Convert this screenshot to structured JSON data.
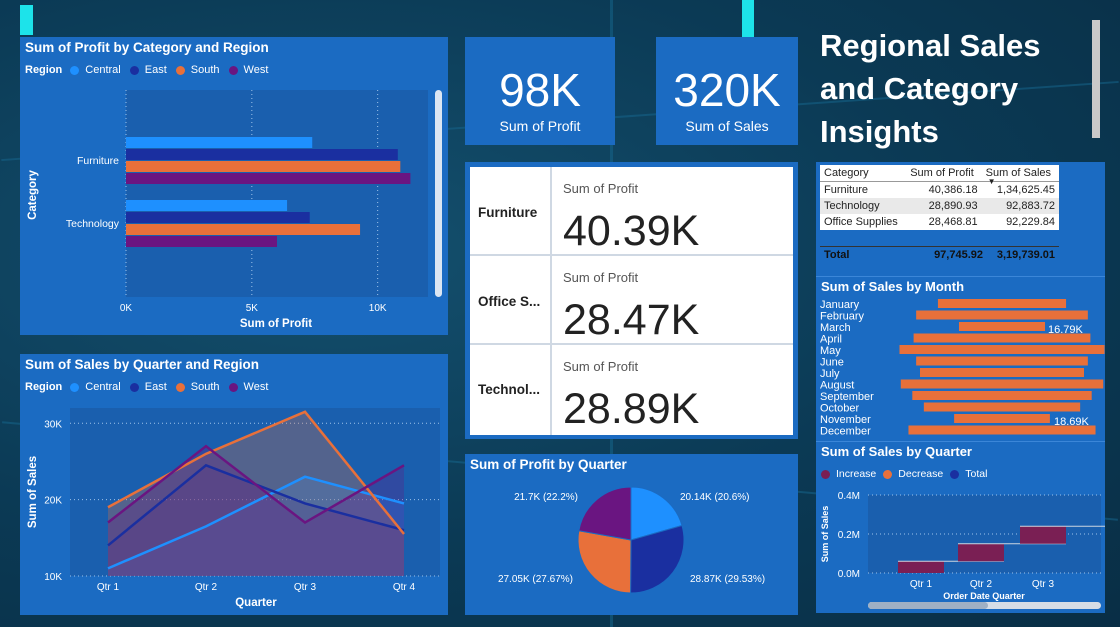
{
  "page_title": "Regional Sales and Category Insights",
  "colors": {
    "central": "#1e90ff",
    "east": "#1a2fa0",
    "south": "#e8703a",
    "west": "#6a1581",
    "panel": "#1b6bc2",
    "increase": "#7a1f54",
    "decrease": "#e8703a",
    "total": "#1a2fa0"
  },
  "kpis": [
    {
      "value": "98K",
      "label": "Sum of Profit"
    },
    {
      "value": "320K",
      "label": "Sum of Sales"
    }
  ],
  "legend": {
    "title": "Region",
    "items": [
      "Central",
      "East",
      "South",
      "West"
    ]
  },
  "profit_by_cat_region": {
    "title": "Sum of Profit by Category and Region",
    "ylabel": "Category",
    "xlabel": "Sum of Profit",
    "ticks": [
      "0K",
      "5K",
      "10K"
    ]
  },
  "sales_by_quarter_region": {
    "title": "Sum of Sales by Quarter and Region",
    "ylabel": "Sum of Sales",
    "xlabel": "Quarter",
    "yticks": [
      "10K",
      "20K",
      "30K"
    ]
  },
  "category_cards": {
    "label": "Sum of Profit",
    "rows": [
      {
        "category": "Furniture",
        "value": "40.39K"
      },
      {
        "category": "Office S...",
        "value": "28.47K"
      },
      {
        "category": "Technol...",
        "value": "28.89K"
      }
    ]
  },
  "profit_by_quarter": {
    "title": "Sum of Profit by Quarter",
    "labels": [
      "20.14K (20.6%)",
      "28.87K (29.53%)",
      "27.05K (27.67%)",
      "21.7K (22.2%)"
    ]
  },
  "matrix": {
    "headers": [
      "Category",
      "Sum of Profit",
      "Sum of Sales"
    ],
    "rows": [
      [
        "Furniture",
        "40,386.18",
        "1,34,625.45"
      ],
      [
        "Technology",
        "28,890.93",
        "92,883.72"
      ],
      [
        "Office Supplies",
        "28,468.81",
        "92,229.84"
      ]
    ],
    "total": [
      "Total",
      "97,745.92",
      "3,19,739.01"
    ]
  },
  "sales_by_month": {
    "title": "Sum of Sales by Month",
    "months": [
      "January",
      "February",
      "March",
      "April",
      "May",
      "June",
      "July",
      "August",
      "September",
      "October",
      "November",
      "December"
    ],
    "annotations": [
      "16.79K",
      "18.69K"
    ]
  },
  "sales_by_quarter_waterfall": {
    "title": "Sum of Sales by Quarter",
    "legend": [
      "Increase",
      "Decrease",
      "Total"
    ],
    "ylabel": "Sum of Sales",
    "xlabel": "Order Date Quarter",
    "yticks": [
      "0.4M",
      "0.2M",
      "0.0M"
    ]
  },
  "chart_data": [
    {
      "type": "bar",
      "orientation": "horizontal",
      "title": "Sum of Profit by Category and Region",
      "categories": [
        "Furniture",
        "Technology"
      ],
      "xlabel": "Sum of Profit",
      "ylabel": "Category",
      "xlim": [
        0,
        12000
      ],
      "series": [
        {
          "name": "Central",
          "values": [
            7400,
            6400
          ]
        },
        {
          "name": "East",
          "values": [
            10800,
            7300
          ]
        },
        {
          "name": "South",
          "values": [
            10900,
            9300
          ]
        },
        {
          "name": "West",
          "values": [
            11300,
            6000
          ]
        }
      ]
    },
    {
      "type": "area",
      "title": "Sum of Sales by Quarter and Region",
      "categories": [
        "Qtr 1",
        "Qtr 2",
        "Qtr 3",
        "Qtr 4"
      ],
      "xlabel": "Quarter",
      "ylabel": "Sum of Sales",
      "ylim": [
        10000,
        32000
      ],
      "series": [
        {
          "name": "Central",
          "values": [
            11000,
            16500,
            23000,
            19500
          ]
        },
        {
          "name": "East",
          "values": [
            14000,
            24500,
            19500,
            16000
          ]
        },
        {
          "name": "South",
          "values": [
            19000,
            26000,
            31500,
            15500
          ]
        },
        {
          "name": "West",
          "values": [
            17000,
            27000,
            17000,
            24500
          ]
        }
      ]
    },
    {
      "type": "pie",
      "title": "Sum of Profit by Quarter",
      "values": [
        20140,
        28870,
        27050,
        21700
      ],
      "labels": [
        "20.14K (20.6%)",
        "28.87K (29.53%)",
        "27.05K (27.67%)",
        "21.7K (22.2%)"
      ]
    },
    {
      "type": "bar",
      "orientation": "horizontal",
      "title": "Sum of Sales by Month",
      "categories": [
        "January",
        "February",
        "March",
        "April",
        "May",
        "June",
        "July",
        "August",
        "September",
        "October",
        "November",
        "December"
      ],
      "values": [
        25000,
        33500,
        16790,
        34500,
        40000,
        33500,
        32000,
        39500,
        35000,
        30500,
        18690,
        36500
      ]
    },
    {
      "type": "bar",
      "subtype": "waterfall",
      "title": "Sum of Sales by Quarter",
      "categories": [
        "Qtr 1",
        "Qtr 2",
        "Qtr 3"
      ],
      "xlabel": "Order Date Quarter",
      "ylabel": "Sum of Sales",
      "ylim": [
        0,
        400000
      ],
      "ranges": [
        [
          0,
          60000
        ],
        [
          60000,
          150000
        ],
        [
          150000,
          240000
        ]
      ]
    }
  ]
}
